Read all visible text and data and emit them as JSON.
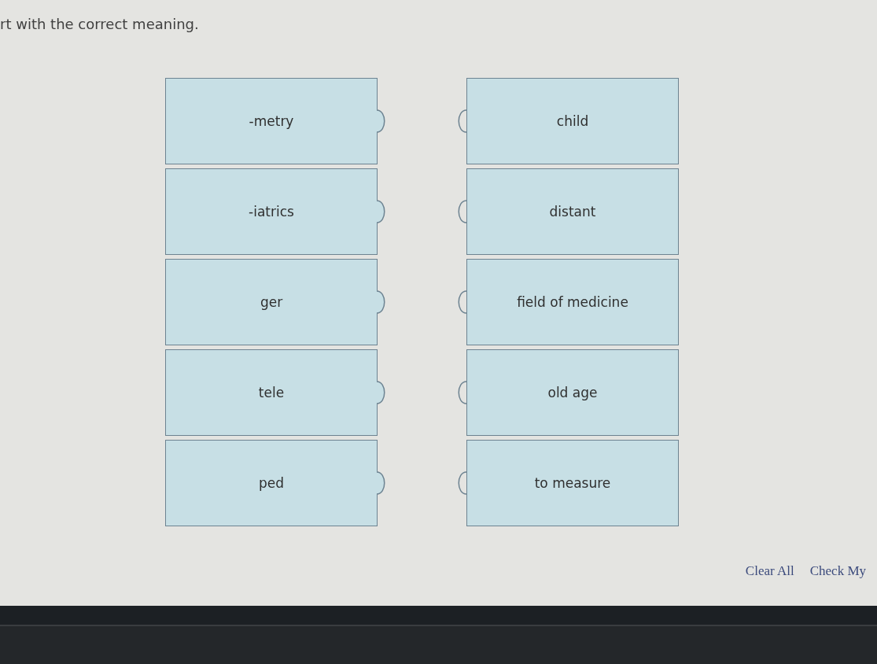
{
  "instruction": "rt with the correct meaning.",
  "word_parts": [
    "-metry",
    "-iatrics",
    "ger",
    "tele",
    "ped"
  ],
  "meanings": [
    "child",
    "distant",
    "field of medicine",
    "old age",
    "to measure"
  ],
  "buttons": [
    "Clear All",
    "Check My"
  ]
}
